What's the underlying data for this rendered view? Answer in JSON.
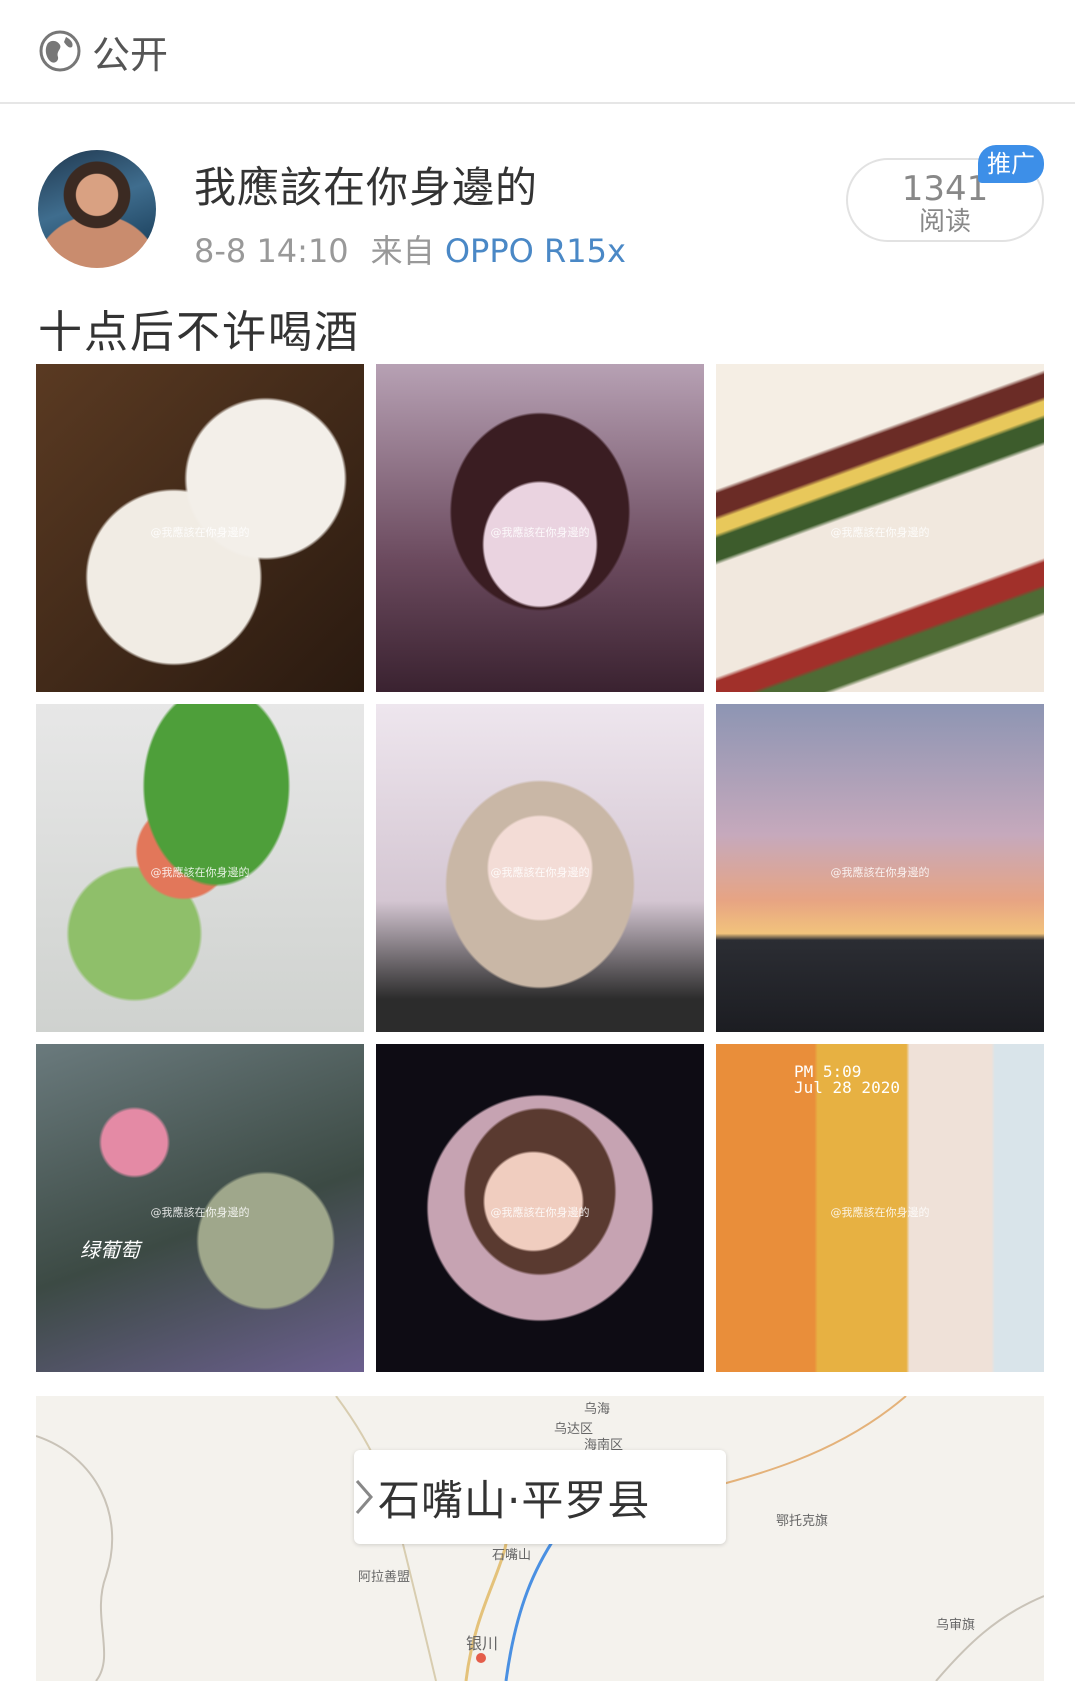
{
  "visibility": {
    "label": "公开",
    "icon": "globe-icon"
  },
  "post": {
    "username": "我應該在你身邊的",
    "time": "8-8 14:10",
    "source_prefix": "来自",
    "device": "OPPO R15x",
    "text": "十点后不许喝酒",
    "read_count": "1341",
    "read_label": "阅读",
    "promo_badge": "推广"
  },
  "images": [
    {
      "watermark": "@我應該在你身邊的"
    },
    {
      "watermark": "@我應該在你身邊的"
    },
    {
      "watermark": "@我應該在你身邊的"
    },
    {
      "watermark": "@我應該在你身邊的"
    },
    {
      "watermark": "@我應該在你身邊的"
    },
    {
      "watermark": "@我應該在你身邊的"
    },
    {
      "watermark": "@我應該在你身邊的"
    },
    {
      "watermark": "@我應該在你身邊的"
    },
    {
      "watermark": "@我應該在你身邊的"
    }
  ],
  "captions": {
    "image7": "绿葡萄",
    "image9_time": "PM 5:09",
    "image9_date": "Jul 28 2020"
  },
  "map": {
    "location": "石嘴山·平罗县",
    "labels": [
      "乌海",
      "乌达区",
      "海南区",
      "鄂托克旗",
      "石嘴山",
      "阿拉善盟",
      "银川",
      "乌审旗"
    ]
  }
}
